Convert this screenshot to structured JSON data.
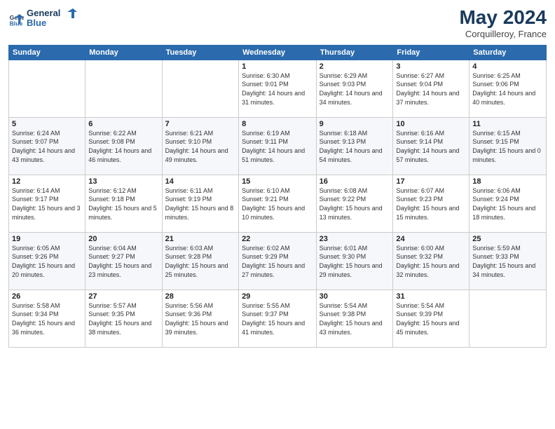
{
  "header": {
    "logo_line1": "General",
    "logo_line2": "Blue",
    "month_title": "May 2024",
    "location": "Corquilleroy, France"
  },
  "weekdays": [
    "Sunday",
    "Monday",
    "Tuesday",
    "Wednesday",
    "Thursday",
    "Friday",
    "Saturday"
  ],
  "weeks": [
    [
      {
        "day": "",
        "info": ""
      },
      {
        "day": "",
        "info": ""
      },
      {
        "day": "",
        "info": ""
      },
      {
        "day": "1",
        "info": "Sunrise: 6:30 AM\nSunset: 9:01 PM\nDaylight: 14 hours\nand 31 minutes."
      },
      {
        "day": "2",
        "info": "Sunrise: 6:29 AM\nSunset: 9:03 PM\nDaylight: 14 hours\nand 34 minutes."
      },
      {
        "day": "3",
        "info": "Sunrise: 6:27 AM\nSunset: 9:04 PM\nDaylight: 14 hours\nand 37 minutes."
      },
      {
        "day": "4",
        "info": "Sunrise: 6:25 AM\nSunset: 9:06 PM\nDaylight: 14 hours\nand 40 minutes."
      }
    ],
    [
      {
        "day": "5",
        "info": "Sunrise: 6:24 AM\nSunset: 9:07 PM\nDaylight: 14 hours\nand 43 minutes."
      },
      {
        "day": "6",
        "info": "Sunrise: 6:22 AM\nSunset: 9:08 PM\nDaylight: 14 hours\nand 46 minutes."
      },
      {
        "day": "7",
        "info": "Sunrise: 6:21 AM\nSunset: 9:10 PM\nDaylight: 14 hours\nand 49 minutes."
      },
      {
        "day": "8",
        "info": "Sunrise: 6:19 AM\nSunset: 9:11 PM\nDaylight: 14 hours\nand 51 minutes."
      },
      {
        "day": "9",
        "info": "Sunrise: 6:18 AM\nSunset: 9:13 PM\nDaylight: 14 hours\nand 54 minutes."
      },
      {
        "day": "10",
        "info": "Sunrise: 6:16 AM\nSunset: 9:14 PM\nDaylight: 14 hours\nand 57 minutes."
      },
      {
        "day": "11",
        "info": "Sunrise: 6:15 AM\nSunset: 9:15 PM\nDaylight: 15 hours\nand 0 minutes."
      }
    ],
    [
      {
        "day": "12",
        "info": "Sunrise: 6:14 AM\nSunset: 9:17 PM\nDaylight: 15 hours\nand 3 minutes."
      },
      {
        "day": "13",
        "info": "Sunrise: 6:12 AM\nSunset: 9:18 PM\nDaylight: 15 hours\nand 5 minutes."
      },
      {
        "day": "14",
        "info": "Sunrise: 6:11 AM\nSunset: 9:19 PM\nDaylight: 15 hours\nand 8 minutes."
      },
      {
        "day": "15",
        "info": "Sunrise: 6:10 AM\nSunset: 9:21 PM\nDaylight: 15 hours\nand 10 minutes."
      },
      {
        "day": "16",
        "info": "Sunrise: 6:08 AM\nSunset: 9:22 PM\nDaylight: 15 hours\nand 13 minutes."
      },
      {
        "day": "17",
        "info": "Sunrise: 6:07 AM\nSunset: 9:23 PM\nDaylight: 15 hours\nand 15 minutes."
      },
      {
        "day": "18",
        "info": "Sunrise: 6:06 AM\nSunset: 9:24 PM\nDaylight: 15 hours\nand 18 minutes."
      }
    ],
    [
      {
        "day": "19",
        "info": "Sunrise: 6:05 AM\nSunset: 9:26 PM\nDaylight: 15 hours\nand 20 minutes."
      },
      {
        "day": "20",
        "info": "Sunrise: 6:04 AM\nSunset: 9:27 PM\nDaylight: 15 hours\nand 23 minutes."
      },
      {
        "day": "21",
        "info": "Sunrise: 6:03 AM\nSunset: 9:28 PM\nDaylight: 15 hours\nand 25 minutes."
      },
      {
        "day": "22",
        "info": "Sunrise: 6:02 AM\nSunset: 9:29 PM\nDaylight: 15 hours\nand 27 minutes."
      },
      {
        "day": "23",
        "info": "Sunrise: 6:01 AM\nSunset: 9:30 PM\nDaylight: 15 hours\nand 29 minutes."
      },
      {
        "day": "24",
        "info": "Sunrise: 6:00 AM\nSunset: 9:32 PM\nDaylight: 15 hours\nand 32 minutes."
      },
      {
        "day": "25",
        "info": "Sunrise: 5:59 AM\nSunset: 9:33 PM\nDaylight: 15 hours\nand 34 minutes."
      }
    ],
    [
      {
        "day": "26",
        "info": "Sunrise: 5:58 AM\nSunset: 9:34 PM\nDaylight: 15 hours\nand 36 minutes."
      },
      {
        "day": "27",
        "info": "Sunrise: 5:57 AM\nSunset: 9:35 PM\nDaylight: 15 hours\nand 38 minutes."
      },
      {
        "day": "28",
        "info": "Sunrise: 5:56 AM\nSunset: 9:36 PM\nDaylight: 15 hours\nand 39 minutes."
      },
      {
        "day": "29",
        "info": "Sunrise: 5:55 AM\nSunset: 9:37 PM\nDaylight: 15 hours\nand 41 minutes."
      },
      {
        "day": "30",
        "info": "Sunrise: 5:54 AM\nSunset: 9:38 PM\nDaylight: 15 hours\nand 43 minutes."
      },
      {
        "day": "31",
        "info": "Sunrise: 5:54 AM\nSunset: 9:39 PM\nDaylight: 15 hours\nand 45 minutes."
      },
      {
        "day": "",
        "info": ""
      }
    ]
  ]
}
